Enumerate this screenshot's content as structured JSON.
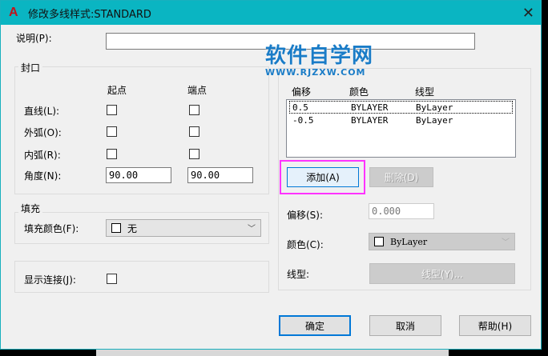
{
  "window": {
    "title": "修改多线样式:STANDARD",
    "close": "✕",
    "logo": "A"
  },
  "description": {
    "label": "说明(P):",
    "value": ""
  },
  "caps": {
    "title": "封口",
    "col_start": "起点",
    "col_end": "端点",
    "rows": [
      {
        "label": "直线(L):",
        "start": false,
        "end": false
      },
      {
        "label": "外弧(O):",
        "start": false,
        "end": false
      },
      {
        "label": "内弧(R):",
        "start": false,
        "end": false
      }
    ],
    "angle_label": "角度(N):",
    "angle_start": "90.00",
    "angle_end": "90.00"
  },
  "fill": {
    "title": "填充",
    "color_label": "填充颜色(F):",
    "color_value": "无"
  },
  "joints": {
    "label": "显示连接(J):",
    "checked": false
  },
  "elements": {
    "headers": [
      "偏移",
      "颜色",
      "线型"
    ],
    "rows": [
      {
        "offset": "0.5",
        "color": "BYLAYER",
        "linetype": "ByLayer"
      },
      {
        "offset": "-0.5",
        "color": "BYLAYER",
        "linetype": "ByLayer"
      }
    ],
    "add": "添加(A)",
    "delete": "删除(D)",
    "offset_label": "偏移(S):",
    "offset_value": "0.000",
    "color_label": "颜色(C):",
    "color_value": "ByLayer",
    "linetype_label": "线型:",
    "linetype_button": "线型(Y)..."
  },
  "footer": {
    "ok": "确定",
    "cancel": "取消",
    "help": "帮助(H)"
  },
  "watermark": {
    "line1": "软件自学网",
    "line2": "WWW.RJZXW.COM"
  },
  "highlight_color": "#ff33ff"
}
